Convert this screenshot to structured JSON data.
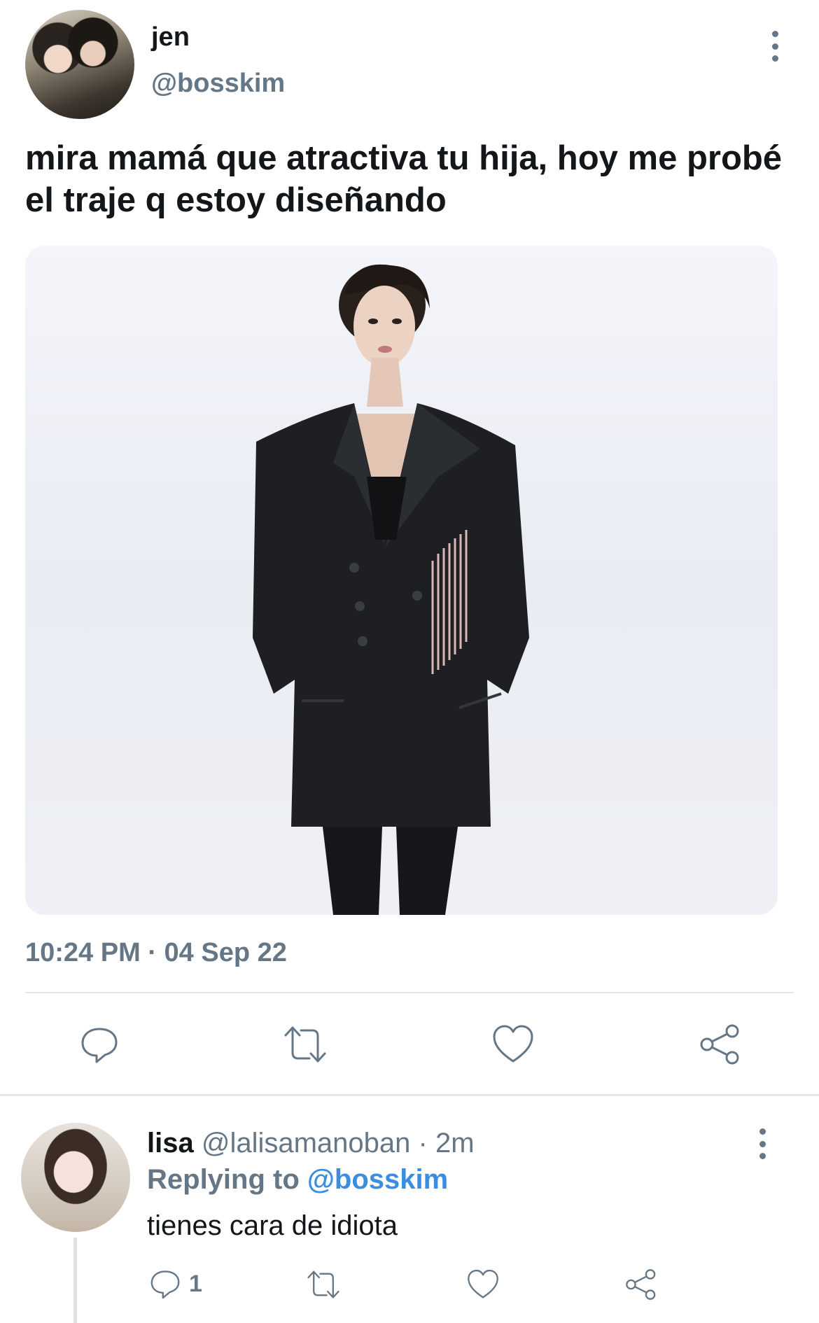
{
  "tweet": {
    "author": {
      "name": "jen",
      "handle": "@bosskim"
    },
    "text": "mira mamá que atractiva tu hija, hoy me probé el traje q estoy diseñando",
    "timestamp": "10:24 PM · 04 Sep 22",
    "actions": [
      "reply-icon",
      "retweet-icon",
      "like-icon",
      "share-icon"
    ]
  },
  "reply": {
    "author": {
      "name": "lisa",
      "handle": "@lalisamanoban",
      "time": "2m"
    },
    "meta_separator": " · ",
    "replying_to_label": "Replying to",
    "replying_to_handle": "@bosskim",
    "text": "tienes cara de idiota",
    "reply_count": "1",
    "actions": [
      "reply-icon",
      "retweet-icon",
      "like-icon",
      "share-icon"
    ]
  },
  "colors": {
    "text_primary": "#14171a",
    "text_secondary": "#657786",
    "mention_link": "#3a8de0",
    "divider": "#e1e8ed"
  }
}
